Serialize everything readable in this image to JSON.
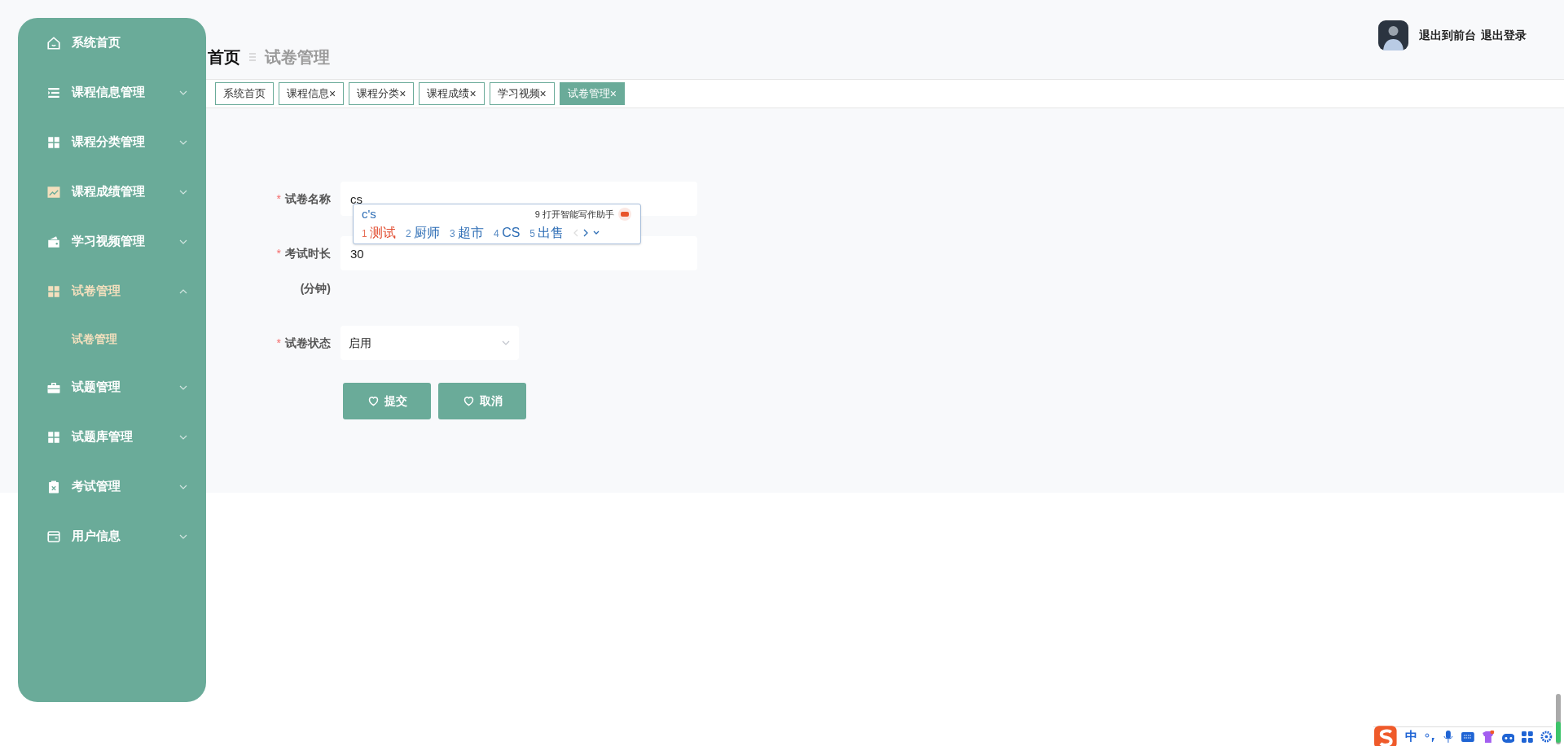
{
  "sidebar": {
    "items": [
      {
        "label": "系统首页",
        "kind": "link",
        "selected": false
      },
      {
        "label": "课程信息管理",
        "kind": "menu",
        "expanded": false,
        "selected": false
      },
      {
        "label": "课程分类管理",
        "kind": "menu",
        "expanded": false,
        "selected": false
      },
      {
        "label": "课程成绩管理",
        "kind": "menu",
        "expanded": false,
        "selected": false
      },
      {
        "label": "学习视频管理",
        "kind": "menu",
        "expanded": false,
        "selected": false
      },
      {
        "label": "试卷管理",
        "kind": "menu",
        "expanded": true,
        "selected": true,
        "children": [
          {
            "label": "试卷管理",
            "selected": true
          }
        ]
      },
      {
        "label": "试题管理",
        "kind": "menu",
        "expanded": false,
        "selected": false
      },
      {
        "label": "试题库管理",
        "kind": "menu",
        "expanded": false,
        "selected": false
      },
      {
        "label": "考试管理",
        "kind": "menu",
        "expanded": false,
        "selected": false
      },
      {
        "label": "用户信息",
        "kind": "menu",
        "expanded": false,
        "selected": false
      }
    ]
  },
  "breadcrumb": [
    "首页",
    "试卷管理"
  ],
  "user": {
    "links": [
      "退出到前台",
      "退出登录"
    ]
  },
  "tabs": [
    {
      "label": "系统首页",
      "selected": false
    },
    {
      "label": "课程信息",
      "close": "×",
      "selected": false
    },
    {
      "label": "课程分类",
      "close": "×",
      "selected": false
    },
    {
      "label": "课程成绩",
      "close": "×",
      "selected": false
    },
    {
      "label": "学习视频",
      "close": "×",
      "selected": false
    },
    {
      "label": "试卷管理",
      "close": "×",
      "selected": true
    }
  ],
  "form": {
    "fields": [
      {
        "kind": "input",
        "label": "试卷名称",
        "required_mark": "*",
        "value": "cs"
      },
      {
        "kind": "input",
        "label": "考试时长",
        "note": "(分钟)",
        "required_mark": "*",
        "value": "30"
      },
      {
        "kind": "select",
        "label": "试卷状态",
        "required_mark": "*",
        "value": "启用"
      }
    ],
    "buttons": [
      "提交",
      "取消"
    ]
  },
  "ime": {
    "composition": "c's",
    "hint_number": "9",
    "hint": "打开智能写作助手",
    "candidates": [
      {
        "number": "1",
        "text": "测试",
        "selected": true
      },
      {
        "number": "2",
        "text": "厨师",
        "selected": false
      },
      {
        "number": "3",
        "text": "超市",
        "selected": false
      },
      {
        "number": "4",
        "text": "CS",
        "selected": false
      },
      {
        "number": "5",
        "text": "出售",
        "selected": false
      }
    ]
  },
  "ime_toolbar": {
    "mode": "中"
  }
}
